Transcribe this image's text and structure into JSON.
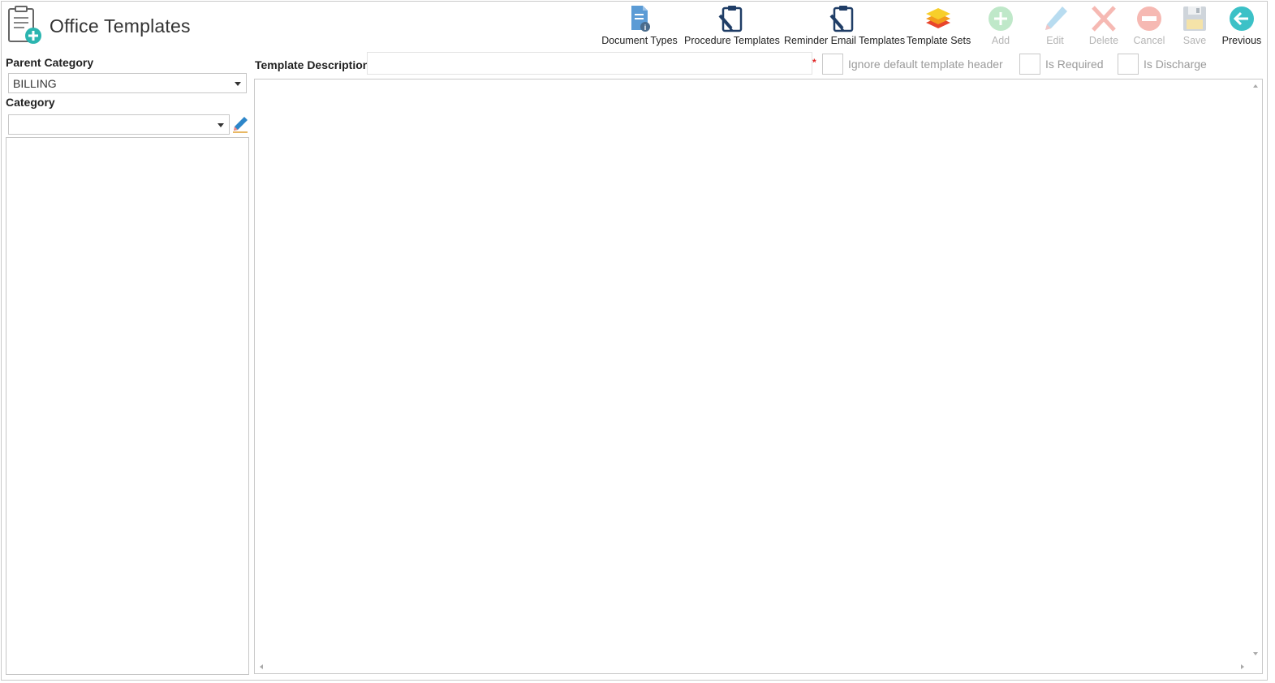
{
  "app": {
    "title": "Office Templates",
    "icon": "clipboard-add-icon"
  },
  "toolbar": {
    "document_types": "Document Types",
    "procedure_templates": "Procedure Templates",
    "reminder_email_templates": "Reminder Email Templates",
    "template_sets": "Template Sets",
    "add": "Add",
    "edit": "Edit",
    "delete": "Delete",
    "cancel": "Cancel",
    "save": "Save",
    "previous": "Previous"
  },
  "left": {
    "parent_category_label": "Parent Category",
    "parent_category_value": "BILLING",
    "category_label": "Category",
    "category_value": ""
  },
  "form": {
    "template_description_label": "Template Description",
    "template_description_value": "",
    "required_marker": "*",
    "ignore_header_label": "Ignore default template header",
    "is_required_label": "Is Required",
    "is_discharge_label": "Is Discharge"
  },
  "colors": {
    "accent_teal": "#2bb5b0",
    "navy": "#1f3d66",
    "disabled_text": "#b5b5b5",
    "required_red": "#e02020"
  }
}
